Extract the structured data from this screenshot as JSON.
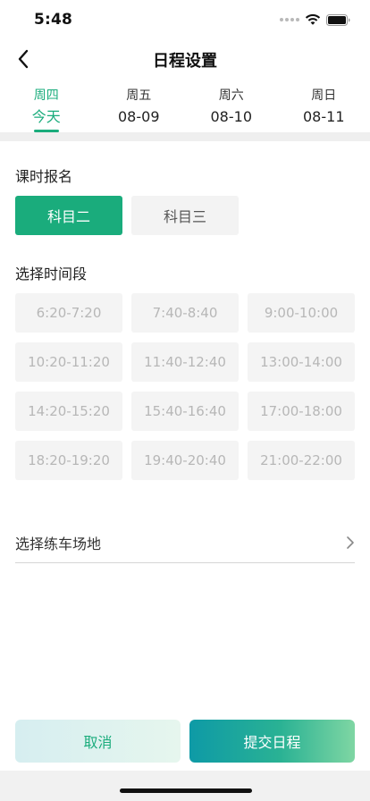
{
  "status_bar": {
    "time": "5:48",
    "icons": [
      "signal-dots-icon",
      "wifi-icon",
      "battery-icon"
    ]
  },
  "nav": {
    "title": "日程设置",
    "back_icon": "chevron-left-icon"
  },
  "day_tabs": [
    {
      "week": "周四",
      "date": "今天",
      "active": true
    },
    {
      "week": "周五",
      "date": "08-09",
      "active": false
    },
    {
      "week": "周六",
      "date": "08-10",
      "active": false
    },
    {
      "week": "周日",
      "date": "08-11",
      "active": false
    }
  ],
  "course_section": {
    "label": "课时报名",
    "options": [
      {
        "label": "科目二",
        "selected": true
      },
      {
        "label": "科目三",
        "selected": false
      }
    ]
  },
  "time_section": {
    "label": "选择时间段",
    "slots": [
      "6:20-7:20",
      "7:40-8:40",
      "9:00-10:00",
      "10:20-11:20",
      "11:40-12:40",
      "13:00-14:00",
      "14:20-15:20",
      "15:40-16:40",
      "17:00-18:00",
      "18:20-19:20",
      "19:40-20:40",
      "21:00-22:00"
    ]
  },
  "venue": {
    "label": "选择练车场地",
    "icon": "chevron-right-icon"
  },
  "actions": {
    "cancel_label": "取消",
    "submit_label": "提交日程"
  },
  "colors": {
    "accent": "#1aac7c",
    "slot_background": "#f4f4f4",
    "slot_text": "#b7b7b7"
  }
}
